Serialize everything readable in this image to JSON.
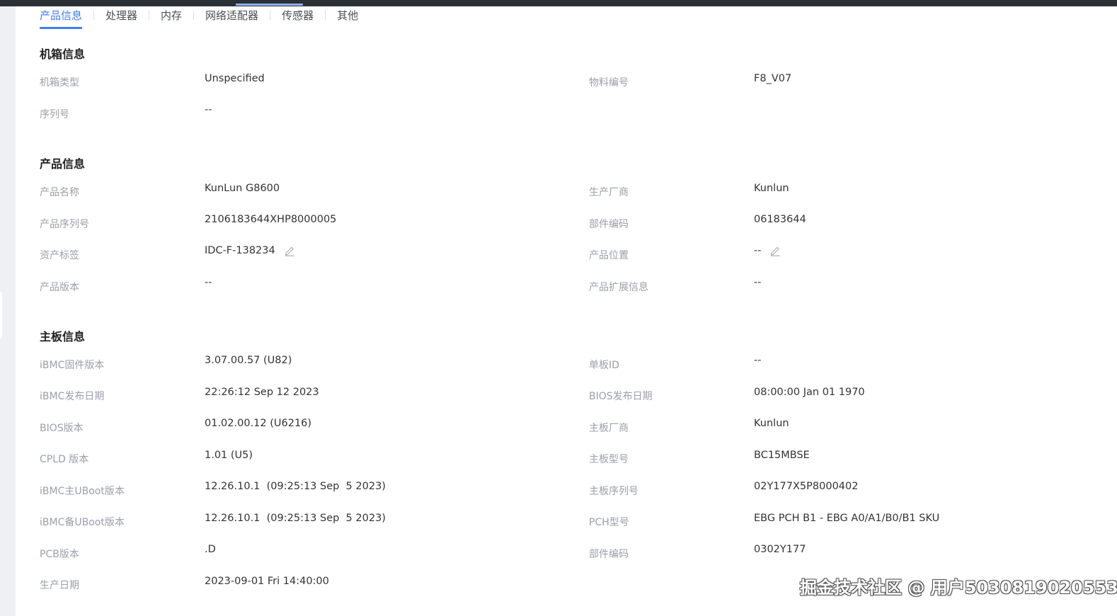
{
  "tabs": [
    {
      "label": "产品信息",
      "active": true
    },
    {
      "label": "处理器",
      "active": false
    },
    {
      "label": "内存",
      "active": false
    },
    {
      "label": "网络适配器",
      "active": false
    },
    {
      "label": "传感器",
      "active": false
    },
    {
      "label": "其他",
      "active": false
    }
  ],
  "chassis": {
    "title": "机箱信息",
    "chassis_type_label": "机箱类型",
    "chassis_type": "Unspecified",
    "material_no_label": "物料编号",
    "material_no": "F8_V07",
    "serial_label": "序列号",
    "serial": "--"
  },
  "product": {
    "title": "产品信息",
    "name_label": "产品名称",
    "name": "KunLun G8600",
    "manufacturer_label": "生产厂商",
    "manufacturer": "Kunlun",
    "serial_label": "产品序列号",
    "serial": "2106183644XHP8000005",
    "part_no_label": "部件编码",
    "part_no": "06183644",
    "asset_tag_label": "资产标签",
    "asset_tag": "IDC-F-138234",
    "location_label": "产品位置",
    "location": "--",
    "version_label": "产品版本",
    "version": "--",
    "ext_info_label": "产品扩展信息",
    "ext_info": "--"
  },
  "board": {
    "title": "主板信息",
    "ibmc_fw_label": "iBMC固件版本",
    "ibmc_fw": "3.07.00.57 (U82)",
    "board_id_label": "单板ID",
    "board_id": "--",
    "ibmc_date_label": "iBMC发布日期",
    "ibmc_date": "22:26:12 Sep 12 2023",
    "bios_date_label": "BIOS发布日期",
    "bios_date": "08:00:00 Jan 01 1970",
    "bios_ver_label": "BIOS版本",
    "bios_ver": "01.02.00.12 (U6216)",
    "board_vendor_label": "主板厂商",
    "board_vendor": "Kunlun",
    "cpld_label": "CPLD 版本",
    "cpld": "1.01 (U5)",
    "board_model_label": "主板型号",
    "board_model": "BC15MBSE",
    "uboot_main_label": "iBMC主UBoot版本",
    "uboot_main": "12.26.10.1  (09:25:13 Sep  5 2023)",
    "board_serial_label": "主板序列号",
    "board_serial": "02Y177X5P8000402",
    "uboot_backup_label": "iBMC备UBoot版本",
    "uboot_backup": "12.26.10.1  (09:25:13 Sep  5 2023)",
    "pch_label": "PCH型号",
    "pch": "EBG PCH B1 - EBG A0/A1/B0/B1 SKU",
    "pcb_label": "PCB版本",
    "pcb": ".D",
    "part_no_label": "部件编码",
    "part_no": "0302Y177",
    "mfg_date_label": "生产日期",
    "mfg_date": "2023-09-01 Fri 14:40:00"
  },
  "watermark": "掘金技术社区 @ 用户5030819020553",
  "icons": {
    "edit": "pencil-edit-icon"
  },
  "colors": {
    "accent": "#3e7df0",
    "label": "#9aa0a8",
    "value": "#333333"
  }
}
